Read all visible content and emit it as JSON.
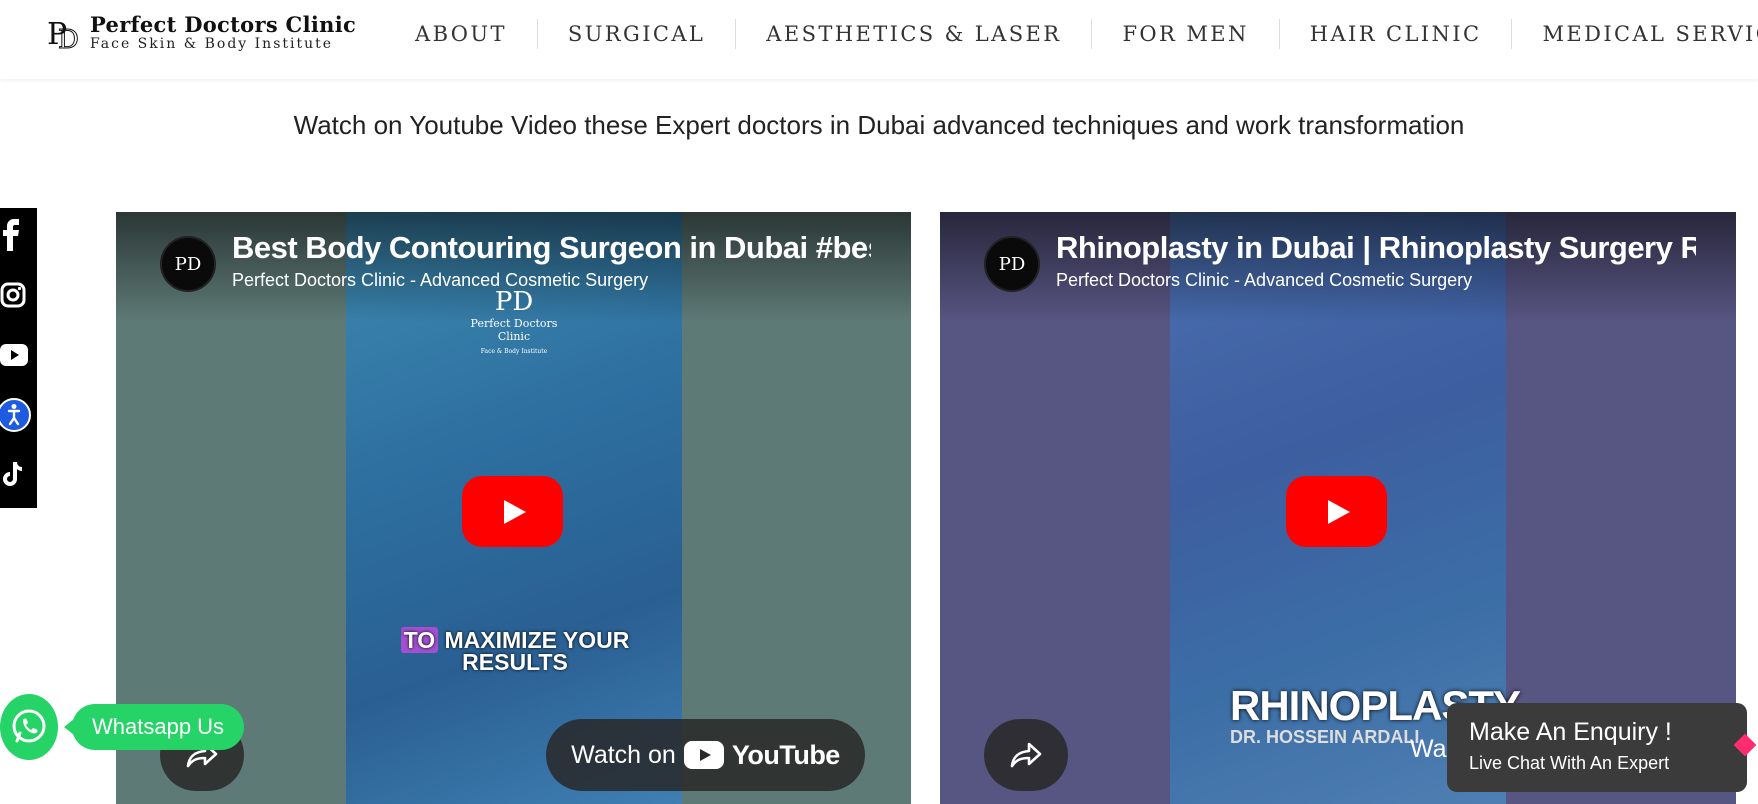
{
  "header": {
    "logo_name": "Perfect Doctors Clinic",
    "logo_sub": "Face Skin & Body Institute",
    "nav": [
      "ABOUT",
      "SURGICAL",
      "AESTHETICS & LASER",
      "FOR MEN",
      "HAIR CLINIC",
      "MEDICAL SERVICES"
    ]
  },
  "intro": "Watch on Youtube Video these Expert doctors in Dubai advanced techniques and work transformation",
  "social": [
    "facebook-icon",
    "instagram-icon",
    "youtube-icon",
    "accessibility-icon",
    "tiktok-icon"
  ],
  "videos": [
    {
      "title": "Best Body Contouring Surgeon in Dubai #bestp",
      "channel": "Perfect Doctors Clinic - Advanced Cosmetic Surgery",
      "overlay_logo_name": "Perfect Doctors Clinic",
      "overlay_logo_sub": "Face & Body Institute",
      "caption_hl": "TO",
      "caption_rest": " MAXIMIZE YOUR RESULTS",
      "watch_label": "Watch on",
      "watch_brand": "YouTube"
    },
    {
      "title": "Rhinoplasty in Dubai | Rhinoplasty Surgery Res",
      "channel": "Perfect Doctors Clinic - Advanced Cosmetic Surgery",
      "overlay_text": "RHINOPLASTY",
      "overlay_sub": "DR. HOSSEIN ARDALI",
      "overlay_partial": "Wa"
    }
  ],
  "whatsapp": {
    "label": "Whatsapp Us"
  },
  "enquiry": {
    "title": "Make An Enquiry !",
    "subtitle": "Live Chat With An Expert"
  },
  "colors": {
    "youtube_red": "#ff0000",
    "whatsapp_green": "#25d366",
    "accessibility_blue": "#1e5be0"
  }
}
